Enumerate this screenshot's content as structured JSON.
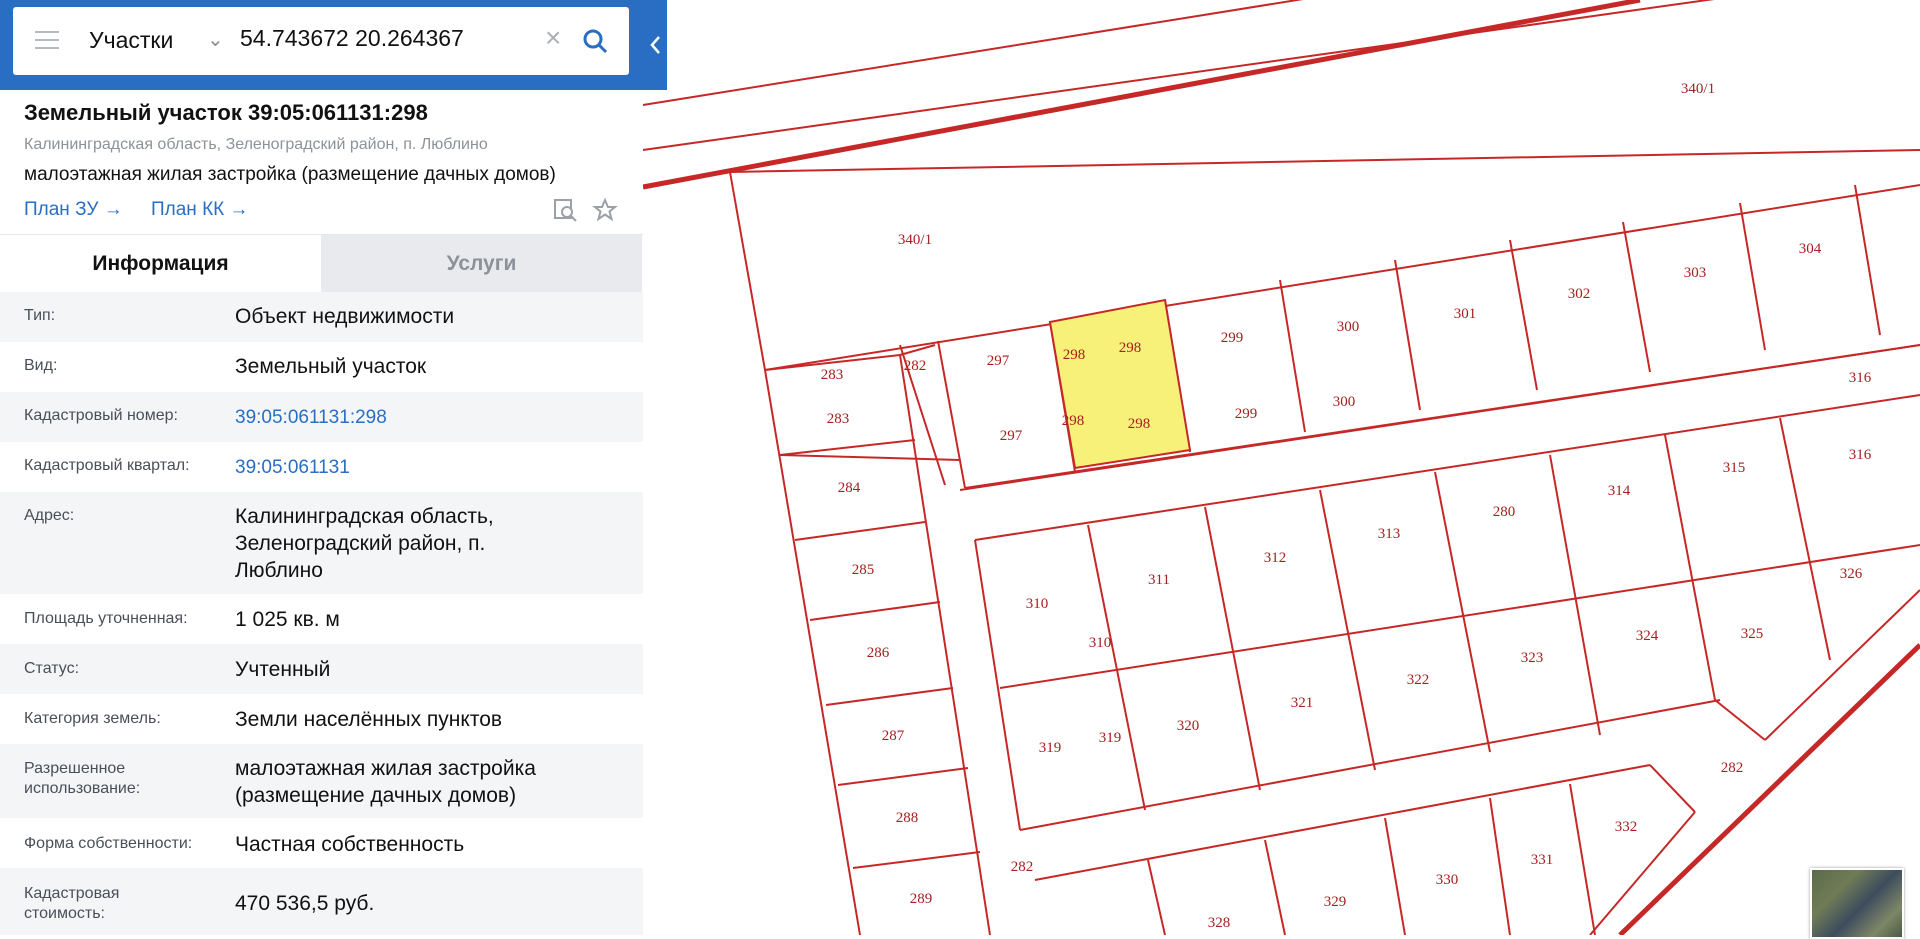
{
  "search": {
    "layer": "Участки",
    "query": "54.743672 20.264367"
  },
  "parcel": {
    "title": "Земельный участок 39:05:061131:298",
    "address": "Калининградская область, Зеленоградский район, п. Люблино",
    "use": "малоэтажная жилая застройка (размещение дачных домов)",
    "plan_zu": "План ЗУ →",
    "plan_kk": "План КК →"
  },
  "tabs": {
    "info": "Информация",
    "services": "Услуги"
  },
  "rows": [
    {
      "label": "Тип:",
      "value": "Объект недвижимости"
    },
    {
      "label": "Вид:",
      "value": "Земельный участок"
    },
    {
      "label": "Кадастровый номер:",
      "value": "39:05:061131:298"
    },
    {
      "label": "Кадастровый квартал:",
      "value": "39:05:061131"
    },
    {
      "label": "Адрес:",
      "value_lines": [
        "Калининградская область,",
        "Зеленоградский район, п.",
        "Люблино"
      ]
    },
    {
      "label": "Площадь уточненная:",
      "value": "1 025 кв. м"
    },
    {
      "label": "Статус:",
      "value": "Учтенный"
    },
    {
      "label": "Категория земель:",
      "value": "Земли населённых пунктов"
    },
    {
      "label_lines": [
        "Разрешенное",
        "использование:"
      ],
      "value_lines": [
        "малоэтажная жилая застройка",
        "(размещение дачных домов)"
      ]
    },
    {
      "label": "Форма собственности:",
      "value": "Частная собственность"
    },
    {
      "label_lines": [
        "Кадастровая",
        "стоимость:"
      ],
      "value": "470 536,5 руб."
    }
  ],
  "map": {
    "line_color": "#c62828",
    "highlight_color": "#f7f17a",
    "labels": [
      "340/1",
      "340/1",
      "283",
      "283",
      "282",
      "297",
      "297",
      "298",
      "298",
      "298",
      "298",
      "299",
      "299",
      "300",
      "300",
      "301",
      "302",
      "303",
      "304",
      "316",
      "316",
      "284",
      "285",
      "286",
      "287",
      "288",
      "289",
      "310",
      "310",
      "311",
      "312",
      "313",
      "280",
      "314",
      "315",
      "326",
      "325",
      "324",
      "323",
      "322",
      "321",
      "320",
      "319",
      "319",
      "282",
      "282",
      "332",
      "331",
      "330",
      "329",
      "328"
    ]
  }
}
